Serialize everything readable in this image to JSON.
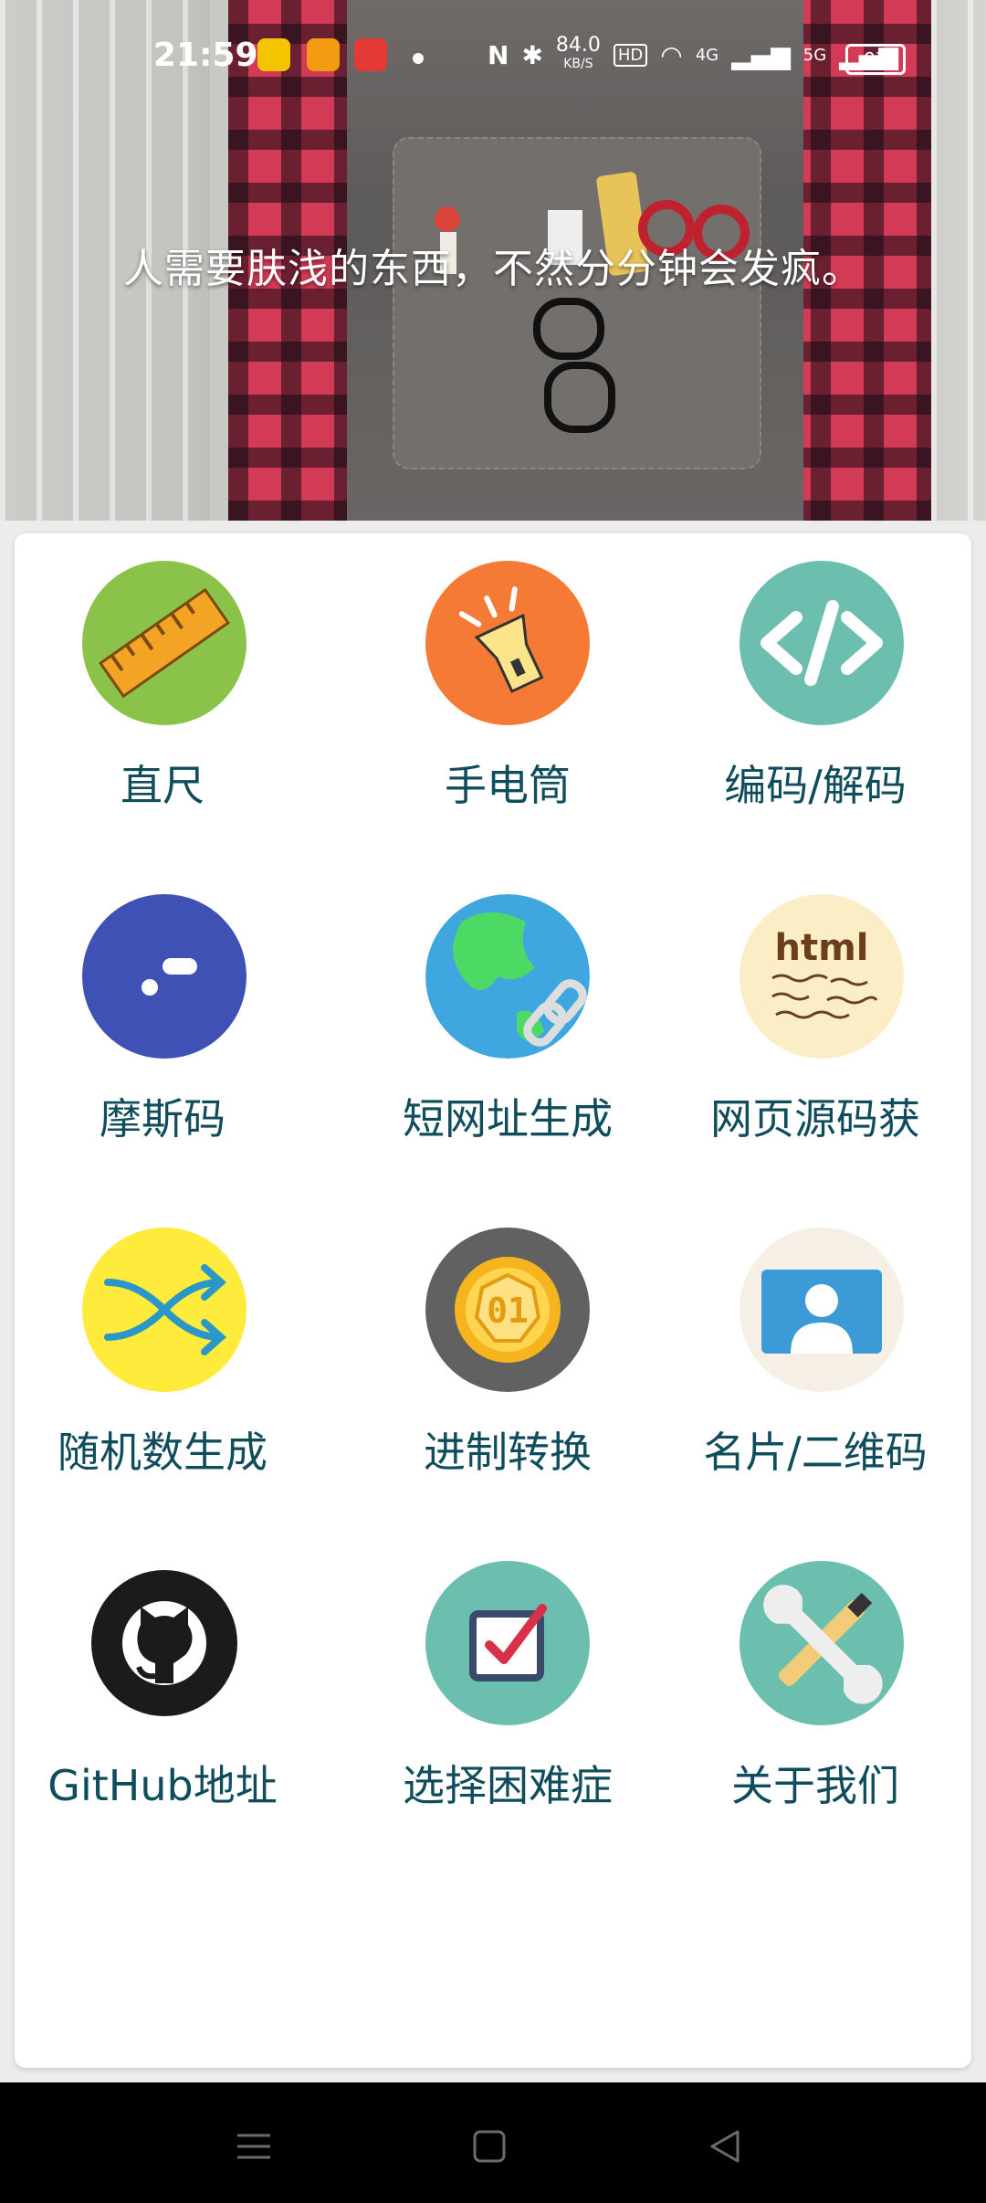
{
  "status_bar": {
    "time": "21:59",
    "speed_value": "84.0",
    "speed_unit": "KB/S",
    "hd_badge": "HD",
    "net_4g": "4G",
    "net_5g": "5G",
    "battery": "97"
  },
  "header": {
    "quote": "人需要肤浅的东西，不然分分钟会发疯。"
  },
  "tools": [
    {
      "label": "直尺",
      "icon": "ruler-icon",
      "bg": "#8bc34a"
    },
    {
      "label": "手电筒",
      "icon": "flashlight-icon",
      "bg": "#f47a36"
    },
    {
      "label": "编码/解码",
      "icon": "code-icon",
      "bg": "#6cbfae"
    },
    {
      "label": "摩斯码",
      "icon": "morse-icon",
      "bg": "#3f51b5"
    },
    {
      "label": "短网址生成",
      "icon": "globe-link-icon",
      "bg": "#ffffff"
    },
    {
      "label": "网页源码获",
      "icon": "html-source-icon",
      "bg": "#fbeec6"
    },
    {
      "label": "随机数生成",
      "icon": "shuffle-icon",
      "bg": "#ffeb3b"
    },
    {
      "label": "进制转换",
      "icon": "binary-coin-icon",
      "bg": "#616161"
    },
    {
      "label": "名片/二维码",
      "icon": "card-qr-icon",
      "bg": "#f5efe6"
    },
    {
      "label": "GitHub地址",
      "icon": "github-icon",
      "bg": "#ffffff"
    },
    {
      "label": "选择困难症",
      "icon": "checkbox-icon",
      "bg": "#6cbfae"
    },
    {
      "label": "关于我们",
      "icon": "tools-icon",
      "bg": "#6cbfae"
    }
  ],
  "colors": {
    "label_text": "#0f4d5c",
    "nav_bg": "#000000"
  }
}
